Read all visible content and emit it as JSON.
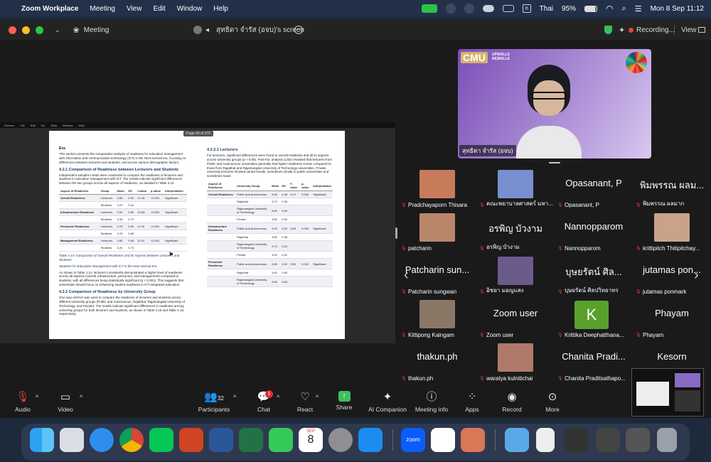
{
  "menubar": {
    "app": "Zoom Workplace",
    "items": [
      "Meeting",
      "View",
      "Edit",
      "Window",
      "Help"
    ],
    "lang": "Thai",
    "battery": "95%",
    "clock": "Mon 8 Sep  11:12"
  },
  "titlebar": {
    "meeting": "Meeting",
    "screen_title": "สุทธิดา จำรัส (อจบ)'s screen",
    "recording": "Recording...",
    "view": "View"
  },
  "share": {
    "page_indicator": "Page 49 of 370",
    "app_menu": [
      "Preview",
      "File",
      "Edit",
      "Go",
      "Tools",
      "Window",
      "Help"
    ]
  },
  "doc": {
    "era": "Era",
    "intro": "This section presents the comparative analysis of readiness for education management with information and communication technology (ICT) in the Next Normal era, focusing on differences between lecturers and students, and across various demographic factors.",
    "h421": "4.2.1 Comparison of Readiness between Lecturers and Students",
    "p421": "Independent samples t-tests were conducted to compare the readiness of lecturers and students in education management with ICT. The results indicate significant differences between the two groups across all aspects of readiness, as detailed in Table 4.14.",
    "table1_headers": [
      "Aspect of Readiness",
      "Group",
      "Mean",
      "SD",
      "t-value",
      "p-value",
      "Interpretation"
    ],
    "table1_rows": [
      [
        "Overall Readiness",
        "Lecturers",
        "3.85",
        "0.52",
        "12.45",
        "<0.001",
        "Significant"
      ],
      [
        "",
        "Students",
        "3.22",
        "0.64",
        "",
        "",
        ""
      ],
      [
        "Infrastructure Readiness",
        "Lecturers",
        "3.92",
        "0.55",
        "10.65",
        "<0.001",
        "Significant"
      ],
      [
        "",
        "Students",
        "3.35",
        "0.72",
        "",
        "",
        ""
      ],
      [
        "Personnel Readiness",
        "Lecturers",
        "3.78",
        "0.60",
        "11.90",
        "<0.001",
        "Significant"
      ],
      [
        "",
        "Students",
        "3.25",
        "0.65",
        "",
        "",
        ""
      ],
      [
        "Management Readiness",
        "Lecturers",
        "3.80",
        "0.58",
        "11.51",
        "<0.001",
        "Significant"
      ],
      [
        "",
        "Students",
        "3.20",
        "0.70",
        "",
        "",
        ""
      ]
    ],
    "caption1": "Table 4.14: Comparison of Overall Readiness and its Aspects between Lecturers and Students",
    "caption1b": "Students for Education Management with ICT in the Next Normal Era",
    "p_after": "As shown in Table 4.14, lecturers consistently demonstrated a higher level of readiness across all aspects (overall, infrastructure, personnel, and management) compared to students, with all differences being statistically significant (p < 0.001). This suggests that universities should focus on enhancing student readiness in ICT-integrated education.",
    "h422": "4.2.2 Comparison of Readiness by University Group",
    "p422": "One-way ANOVA was used to compare the readiness of lecturers and students across different university groups (Public and Autonomous, Rajabhat, Rajamangala University of Technology, and Private). The results indicate significant differences in readiness among university groups for both lecturers and students, as shown in Table 4.15 and Table 4.16, respectively.",
    "h4221": "4.2.2.1 Lecturers",
    "p4221": "For lecturers, significant differences were found in overall readiness and all its aspects across university groups (p < 0.05). Post-hoc analysis (LSD) revealed that lecturers from Public and Autonomous universities generally had higher readiness scores compared to those from Rajabhat and Rajamangala University of Technology universities. Private university lecturers showed varied results, sometimes similar to public universities and sometimes lower.",
    "table2_headers": [
      "Aspect of Readiness",
      "University Group",
      "Mean",
      "SD",
      "F-value",
      "p-value",
      "Interpretation"
    ],
    "table2_rows": [
      [
        "Overall Readiness",
        "Public and Autonomous",
        "3.95",
        "0.48",
        "4.23",
        "0.006",
        "Significant"
      ],
      [
        "",
        "Rajabhat",
        "3.70",
        "0.55",
        "",
        "",
        ""
      ],
      [
        "",
        "Rajamangala University of Technology",
        "3.65",
        "0.60",
        "",
        "",
        ""
      ],
      [
        "",
        "Private",
        "3.80",
        "0.50",
        "",
        "",
        ""
      ],
      [
        "Infrastructure Readiness",
        "Public and Autonomous",
        "4.00",
        "0.50",
        "3.89",
        "0.009",
        "Significant"
      ],
      [
        "",
        "Rajabhat",
        "3.80",
        "0.58",
        "",
        "",
        ""
      ],
      [
        "",
        "Rajamangala University of Technology",
        "3.70",
        "0.62",
        "",
        "",
        ""
      ],
      [
        "",
        "Private",
        "3.90",
        "0.52",
        "",
        "",
        ""
      ],
      [
        "Personnel Readiness",
        "Public and Autonomous",
        "3.85",
        "0.52",
        "3.55",
        "0.015",
        "Significant"
      ],
      [
        "",
        "Rajabhat",
        "3.60",
        "0.60",
        "",
        "",
        ""
      ],
      [
        "",
        "Rajamangala University of Technology",
        "3.55",
        "0.65",
        "",
        "",
        ""
      ]
    ]
  },
  "speaker": {
    "name": "สุทธิดา จำรัส (อจบ)",
    "banner": "UPSKILLS RESKILLS",
    "logo": "CMU"
  },
  "participants": [
    {
      "name": "Pradchayaporn Thisara",
      "big": ""
    },
    {
      "name": "คณะพยาบาลศาสตร์ มหา...",
      "big": ""
    },
    {
      "name": "Opasanant, P",
      "big": "Opasanant, P"
    },
    {
      "name": "พิมพรรณ ผลมาก",
      "big": "พิมพรรณ ผลม..."
    },
    {
      "name": "patcharin",
      "big": ""
    },
    {
      "name": "อรพิญ บัวงาม",
      "big": "อรพิญ บัวงาม"
    },
    {
      "name": "Nannopparom",
      "big": "Nannopparom"
    },
    {
      "name": "krittipitch Thitipitchay...",
      "big": ""
    },
    {
      "name": "Patcharin sungwan",
      "big": "Patcharin sun..."
    },
    {
      "name": "อิชยา มอญแสง",
      "big": ""
    },
    {
      "name": "บุษยรัตน์ ศิลปวิทยาทร",
      "big": "บุษยรัตน์ ศิล..."
    },
    {
      "name": "jutamas ponmark",
      "big": "jutamas pon..."
    },
    {
      "name": "Kittipong Kaingam",
      "big": ""
    },
    {
      "name": "Zoom user",
      "big": "Zoom user"
    },
    {
      "name": "Krittika Deephatthana...",
      "big": "K"
    },
    {
      "name": "Phayam",
      "big": "Phayam"
    },
    {
      "name": "thakun.ph",
      "big": "thakun.ph"
    },
    {
      "name": "waratya kulnitichai",
      "big": ""
    },
    {
      "name": "Chanita Praditsathapo...",
      "big": "Chanita Pradi..."
    },
    {
      "name": "",
      "big": "Kesorn"
    }
  ],
  "toolbar": {
    "audio": "Audio",
    "video": "Video",
    "participants": "Participants",
    "participants_count": "32",
    "chat": "Chat",
    "chat_badge": "1",
    "react": "React",
    "share": "Share",
    "ai": "AI Companion",
    "info": "Meeting info",
    "apps": "Apps",
    "record": "Record",
    "more": "More"
  },
  "dock": {
    "calendar_month": "SEP",
    "calendar_day": "8",
    "zoom": "zoom"
  }
}
